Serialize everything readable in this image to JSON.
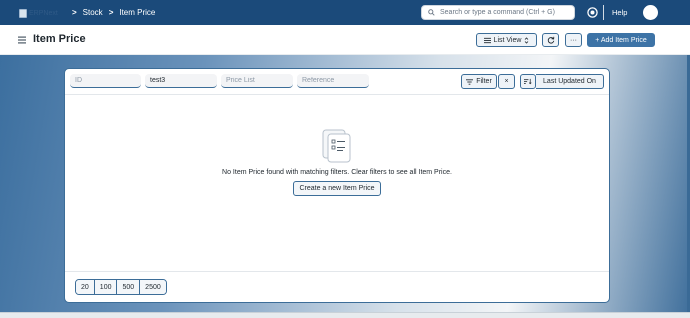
{
  "navbar": {
    "logo_alt": "ERPNext",
    "breadcrumbs": [
      "Stock",
      "Item Price"
    ],
    "search_placeholder": "Search or type a command (Ctrl + G)",
    "help_label": "Help"
  },
  "page": {
    "title": "Item Price",
    "list_view_label": "List View",
    "more_label": "···",
    "add_label": "+ Add Item Price"
  },
  "filters": {
    "id_placeholder": "ID",
    "item_value": "test3",
    "price_list_placeholder": "Price List",
    "reference_placeholder": "Reference",
    "filter_label": "Filter",
    "clear_label": "×",
    "sort_label": "Last Updated On"
  },
  "empty_state": {
    "message": "No Item Price found with matching filters. Clear filters to see all Item Price.",
    "create_label": "Create a new Item Price"
  },
  "paging": [
    "20",
    "100",
    "500",
    "2500"
  ],
  "colors": {
    "navbar": "#1b4a7a",
    "accent": "#3c6d98",
    "primary_button": "#3d73a6"
  }
}
